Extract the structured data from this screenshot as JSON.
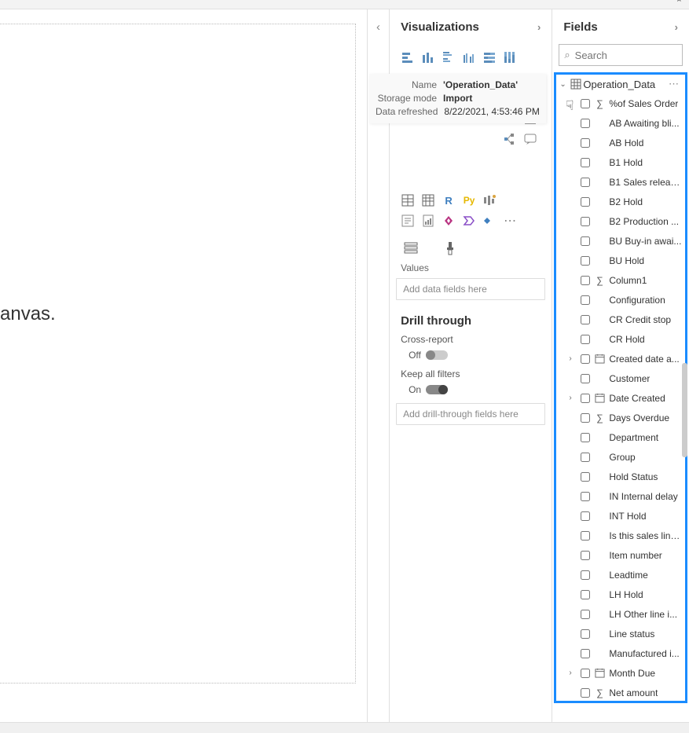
{
  "canvas": {
    "placeholder_fragment": "anvas."
  },
  "panes": {
    "visualizations": {
      "title": "Visualizations"
    },
    "fields": {
      "title": "Fields"
    }
  },
  "search": {
    "placeholder": "Search"
  },
  "viz": {
    "values_label": "Values",
    "values_placeholder": "Add data fields here",
    "drill_header": "Drill through",
    "cross_report_label": "Cross-report",
    "cross_report_state": "Off",
    "keep_filters_label": "Keep all filters",
    "keep_filters_state": "On",
    "drill_placeholder": "Add drill-through fields here"
  },
  "tooltip": {
    "name_label": "Name",
    "name_value": "'Operation_Data'",
    "storage_label": "Storage mode",
    "storage_value": "Import",
    "refreshed_label": "Data refreshed",
    "refreshed_value": "8/22/2021, 4:53:46 PM"
  },
  "table": {
    "name": "Operation_Data",
    "fields": [
      {
        "label": "%of Sales Order",
        "icon": "sigma",
        "expandable": false
      },
      {
        "label": "AB Awaiting bli...",
        "icon": "",
        "expandable": false
      },
      {
        "label": "AB Hold",
        "icon": "",
        "expandable": false
      },
      {
        "label": "B1 Hold",
        "icon": "",
        "expandable": false
      },
      {
        "label": "B1 Sales releas...",
        "icon": "",
        "expandable": false
      },
      {
        "label": "B2 Hold",
        "icon": "",
        "expandable": false
      },
      {
        "label": "B2 Production ...",
        "icon": "",
        "expandable": false
      },
      {
        "label": "BU Buy-in awai...",
        "icon": "",
        "expandable": false
      },
      {
        "label": "BU Hold",
        "icon": "",
        "expandable": false
      },
      {
        "label": "Column1",
        "icon": "sigma",
        "expandable": false
      },
      {
        "label": "Configuration",
        "icon": "",
        "expandable": false
      },
      {
        "label": "CR Credit stop",
        "icon": "",
        "expandable": false
      },
      {
        "label": "CR Hold",
        "icon": "",
        "expandable": false
      },
      {
        "label": "Created date a...",
        "icon": "calendar",
        "expandable": true
      },
      {
        "label": "Customer",
        "icon": "",
        "expandable": false
      },
      {
        "label": "Date Created",
        "icon": "calendar",
        "expandable": true
      },
      {
        "label": "Days Overdue",
        "icon": "sigma",
        "expandable": false
      },
      {
        "label": "Department",
        "icon": "",
        "expandable": false
      },
      {
        "label": "Group",
        "icon": "",
        "expandable": false
      },
      {
        "label": "Hold Status",
        "icon": "",
        "expandable": false
      },
      {
        "label": "IN Internal delay",
        "icon": "",
        "expandable": false
      },
      {
        "label": "INT Hold",
        "icon": "",
        "expandable": false
      },
      {
        "label": "Is this sales line...",
        "icon": "",
        "expandable": false
      },
      {
        "label": "Item number",
        "icon": "",
        "expandable": false
      },
      {
        "label": "Leadtime",
        "icon": "",
        "expandable": false
      },
      {
        "label": "LH Hold",
        "icon": "",
        "expandable": false
      },
      {
        "label": "LH Other line i...",
        "icon": "",
        "expandable": false
      },
      {
        "label": "Line status",
        "icon": "",
        "expandable": false
      },
      {
        "label": "Manufactured i...",
        "icon": "",
        "expandable": false
      },
      {
        "label": "Month Due",
        "icon": "calendar",
        "expandable": true
      },
      {
        "label": "Net amount",
        "icon": "sigma",
        "expandable": false
      }
    ]
  }
}
